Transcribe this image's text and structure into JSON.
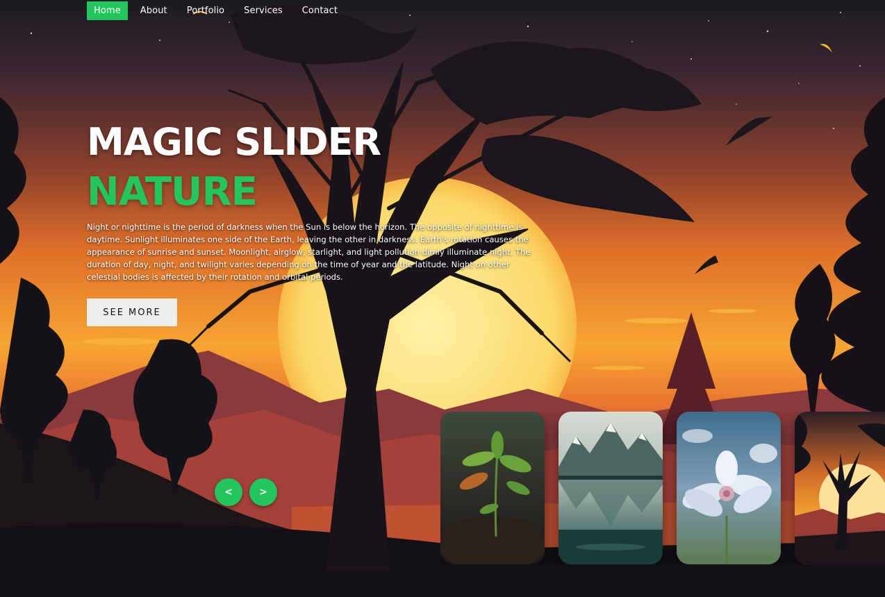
{
  "nav": {
    "items": [
      {
        "label": "Home",
        "active": true
      },
      {
        "label": "About",
        "active": false
      },
      {
        "label": "Portfolio",
        "active": false
      },
      {
        "label": "Services",
        "active": false
      },
      {
        "label": "Contact",
        "active": false
      }
    ]
  },
  "hero": {
    "title": "MAGIC SLIDER",
    "topic": "NATURE",
    "description": "Night or nighttime is the period of darkness when the Sun is below the horizon. The opposite of nighttime is daytime. Sunlight illuminates one side of the Earth, leaving the other in darkness. Earth's rotation causes the appearance of sunrise and sunset. Moonlight, airglow, starlight, and light pollution dimly illuminate night. The duration of day, night, and twilight varies depending on the time of year and the latitude. Night on other celestial bodies is affected by their rotation and orbital periods.",
    "button_label": "SEE MORE"
  },
  "controls": {
    "prev_label": "<",
    "next_label": ">"
  },
  "thumbnails": [
    {
      "icon": "sprout-thumbnail"
    },
    {
      "icon": "mountain-lake-thumbnail"
    },
    {
      "icon": "flower-thumbnail"
    },
    {
      "icon": "sunset-tree-thumbnail"
    }
  ],
  "colors": {
    "accent": "#22c55e",
    "sky_top": "#1d1a22",
    "sun": "#fde68a",
    "sunset_orange": "#f59e0b"
  }
}
